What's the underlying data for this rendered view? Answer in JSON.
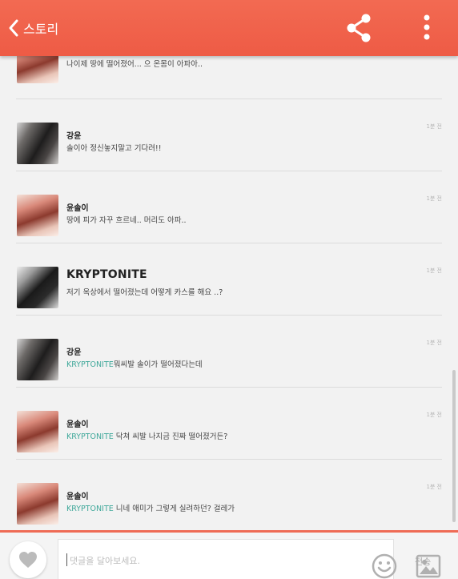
{
  "header": {
    "back_label": "스토리"
  },
  "comments": [
    {
      "user": "",
      "message": "나이제 땅에 떨어졌어... 으 온몸이 아파아..",
      "mention": "",
      "time": ""
    },
    {
      "user": "강윤",
      "message": "솔이아 정신놓지말고 기다려!!",
      "mention": "",
      "time": "1분 전"
    },
    {
      "user": "윤솔이",
      "message": "땅에 피가 자꾸 흐르네.. 머리도 아파..",
      "mention": "",
      "time": "1분 전"
    },
    {
      "user": "KRYPTONITE",
      "message": "저기 옥상에서 떨어졌는데 어떻게 카스를 해요 ..?",
      "mention": "",
      "time": "1분 전"
    },
    {
      "user": "강윤",
      "message": "뭐씨발 솔이가 떨어졌다는데",
      "mention": "KRYPTONITE",
      "time": "1분 전"
    },
    {
      "user": "윤솔이",
      "message": " 닥쳐 씨발 나지금 진짜 떨어졌거든?",
      "mention": "KRYPTONITE",
      "time": "1분 전"
    },
    {
      "user": "윤솔이",
      "message": " 니네 애미가 그렇게 실려하던? 걸레가",
      "mention": "KRYPTONITE",
      "time": "1분 전"
    }
  ],
  "composer": {
    "placeholder": "댓글을 달아보세요.",
    "send_label": "전송"
  }
}
